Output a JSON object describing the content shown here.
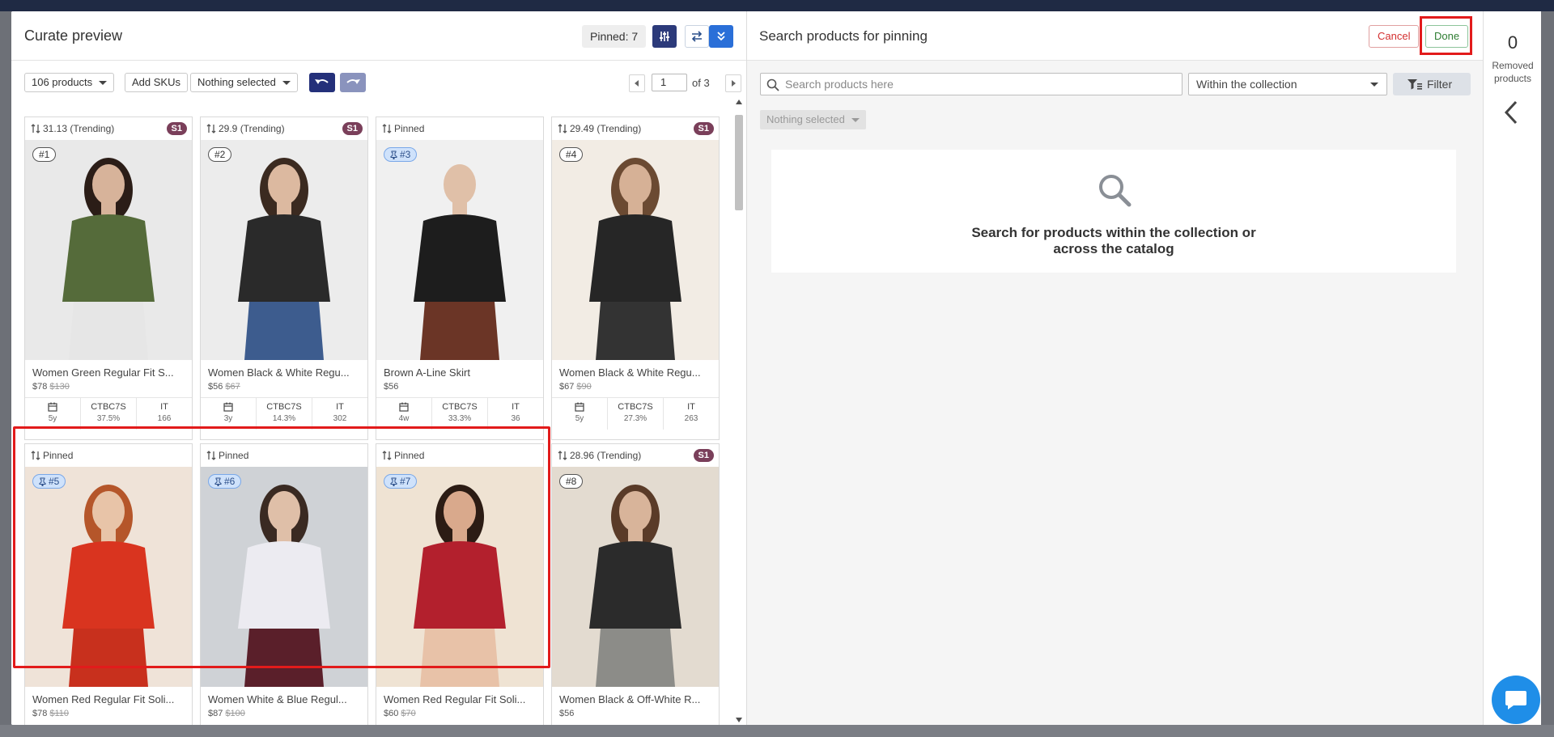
{
  "left": {
    "title": "Curate preview",
    "pinned_label": "Pinned: 7",
    "toolbar": {
      "product_count": "106 products",
      "add_skus": "Add SKUs",
      "selection": "Nothing selected",
      "page_value": "1",
      "page_of": "of 3"
    },
    "cards": [
      {
        "top": "31.13 (Trending)",
        "badge": "S1",
        "rank": "#1",
        "pinned": false,
        "name": "Women Green Regular Fit S...",
        "price": "$78",
        "old_price": "$130",
        "metrics": [
          {
            "label": "",
            "value": "5y"
          },
          {
            "label": "CTBC7S",
            "value": "37.5%"
          },
          {
            "label": "IT",
            "value": "166"
          }
        ],
        "img": {
          "bg": "#e9e9e9",
          "top": "#556b3a",
          "skin": "#d7b39a",
          "hair": "#2b1d17",
          "bottom": "#e6e6e6"
        }
      },
      {
        "top": "29.9 (Trending)",
        "badge": "S1",
        "rank": "#2",
        "pinned": false,
        "name": "Women Black & White Regu...",
        "price": "$56",
        "old_price": "$67",
        "metrics": [
          {
            "label": "",
            "value": "3y"
          },
          {
            "label": "CTBC7S",
            "value": "14.3%"
          },
          {
            "label": "IT",
            "value": "302"
          }
        ],
        "img": {
          "bg": "#ececec",
          "top": "#2a2a2a",
          "skin": "#dcb9a0",
          "hair": "#3b2a20",
          "bottom": "#3d5c8e"
        }
      },
      {
        "top": "Pinned",
        "badge": "",
        "rank": "#3",
        "pinned": true,
        "name": "Brown A-Line Skirt",
        "price": "$56",
        "old_price": "",
        "metrics": [
          {
            "label": "",
            "value": "4w"
          },
          {
            "label": "CTBC7S",
            "value": "33.3%"
          },
          {
            "label": "IT",
            "value": "36"
          }
        ],
        "img": {
          "bg": "#f0f0f0",
          "top": "#1d1d1d",
          "skin": "#e0c0a8",
          "hair": "#f0f0f0",
          "bottom": "#6b3526"
        }
      },
      {
        "top": "29.49 (Trending)",
        "badge": "S1",
        "rank": "#4",
        "pinned": false,
        "name": "Women Black & White Regu...",
        "price": "$67",
        "old_price": "$90",
        "metrics": [
          {
            "label": "",
            "value": "5y"
          },
          {
            "label": "CTBC7S",
            "value": "27.3%"
          },
          {
            "label": "IT",
            "value": "263"
          }
        ],
        "img": {
          "bg": "#f2ece4",
          "top": "#262626",
          "skin": "#d6b196",
          "hair": "#6b4a32",
          "bottom": "#333333"
        }
      },
      {
        "top": "Pinned",
        "badge": "",
        "rank": "#5",
        "pinned": true,
        "name": "Women Red Regular Fit Soli...",
        "price": "$78",
        "old_price": "$110",
        "metrics": [],
        "img": {
          "bg": "#efe3d8",
          "top": "#d9341f",
          "skin": "#e8c4a8",
          "hair": "#b5562a",
          "bottom": "#c8301d"
        }
      },
      {
        "top": "Pinned",
        "badge": "",
        "rank": "#6",
        "pinned": true,
        "name": "Women White & Blue Regul...",
        "price": "$87",
        "old_price": "$100",
        "metrics": [],
        "img": {
          "bg": "#cfd2d6",
          "top": "#ecebf1",
          "skin": "#dfbfa8",
          "hair": "#3a2a22",
          "bottom": "#5a1f2a"
        }
      },
      {
        "top": "Pinned",
        "badge": "",
        "rank": "#7",
        "pinned": true,
        "name": "Women Red Regular Fit Soli...",
        "price": "$60",
        "old_price": "$70",
        "metrics": [],
        "img": {
          "bg": "#efe3d3",
          "top": "#b3202d",
          "skin": "#d9a98c",
          "hair": "#2c1c14",
          "bottom": "#e8c2a8"
        }
      },
      {
        "top": "28.96 (Trending)",
        "badge": "S1",
        "rank": "#8",
        "pinned": false,
        "name": "Women Black & Off-White R...",
        "price": "$56",
        "old_price": "",
        "metrics": [],
        "img": {
          "bg": "#e3dbd0",
          "top": "#2b2b2b",
          "skin": "#d8b49a",
          "hair": "#5a3b28",
          "bottom": "#8c8c88"
        }
      }
    ]
  },
  "right": {
    "title": "Search products for pinning",
    "cancel": "Cancel",
    "done": "Done",
    "search_placeholder": "Search products here",
    "scope": "Within the collection",
    "filter": "Filter",
    "selection": "Nothing selected",
    "empty_line1": "Search for products within the collection or",
    "empty_line2": "across the catalog"
  },
  "side": {
    "removed_count": "0",
    "removed_label_1": "Removed",
    "removed_label_2": "products"
  },
  "colors": {
    "accent_navy": "#2c3a7a",
    "accent_blue": "#2a6fd8",
    "badge": "#7a3f5a",
    "highlight": "#e21b1b"
  }
}
